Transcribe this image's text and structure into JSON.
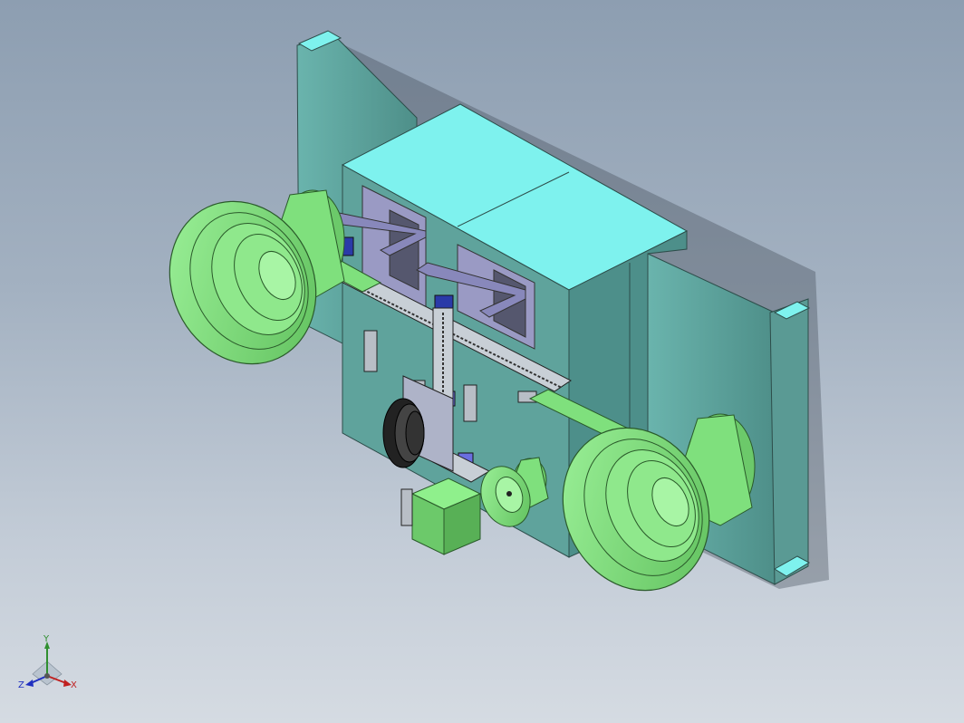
{
  "viewport": {
    "background_top": "#8d9eb1",
    "background_bottom": "#d5dbe2"
  },
  "model": {
    "colors": {
      "frame": "#5fa39c",
      "frame_light": "#7ef2ee",
      "bowl": "#7fe07d",
      "bowl_dark": "#4e9d4e",
      "bracket": "#8d8db8",
      "motor": "#2a3aa8",
      "block": "#6fcf6c",
      "rail": "#bfc7cf"
    }
  },
  "triad": {
    "y_label": "Y",
    "x_label": "X",
    "z_label": "Z",
    "icon": "coordinate-triad-icon"
  }
}
